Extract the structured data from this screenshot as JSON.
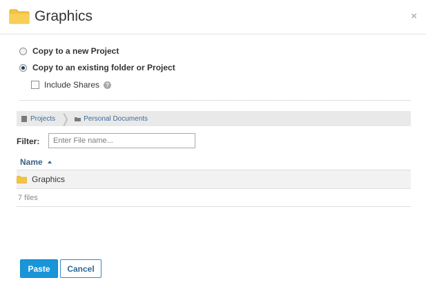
{
  "dialog": {
    "title": "Graphics",
    "close_label": "×"
  },
  "options": {
    "new_project": "Copy to a new Project",
    "existing_folder": "Copy to an existing folder or Project",
    "selected": "existing_folder",
    "include_shares": "Include Shares",
    "include_shares_checked": false
  },
  "breadcrumb": {
    "items": [
      "Projects",
      "Personal Documents"
    ]
  },
  "filter": {
    "label": "Filter:",
    "placeholder": "Enter File name...",
    "value": ""
  },
  "table": {
    "column_name": "Name",
    "sort": "ascending",
    "rows": [
      {
        "name": "Graphics",
        "type": "folder"
      }
    ],
    "count_text": "7 files"
  },
  "buttons": {
    "paste": "Paste",
    "cancel": "Cancel"
  },
  "colors": {
    "primary": "#1995d8",
    "link": "#3b6b9c",
    "folder": "#f5c342"
  },
  "icons": {
    "header": "folder-icon",
    "close": "close-icon",
    "help": "help-icon",
    "breadcrumb_projects": "project-icon",
    "breadcrumb_folder": "folder-icon",
    "sort": "sort-ascending-icon",
    "row": "folder-icon"
  }
}
